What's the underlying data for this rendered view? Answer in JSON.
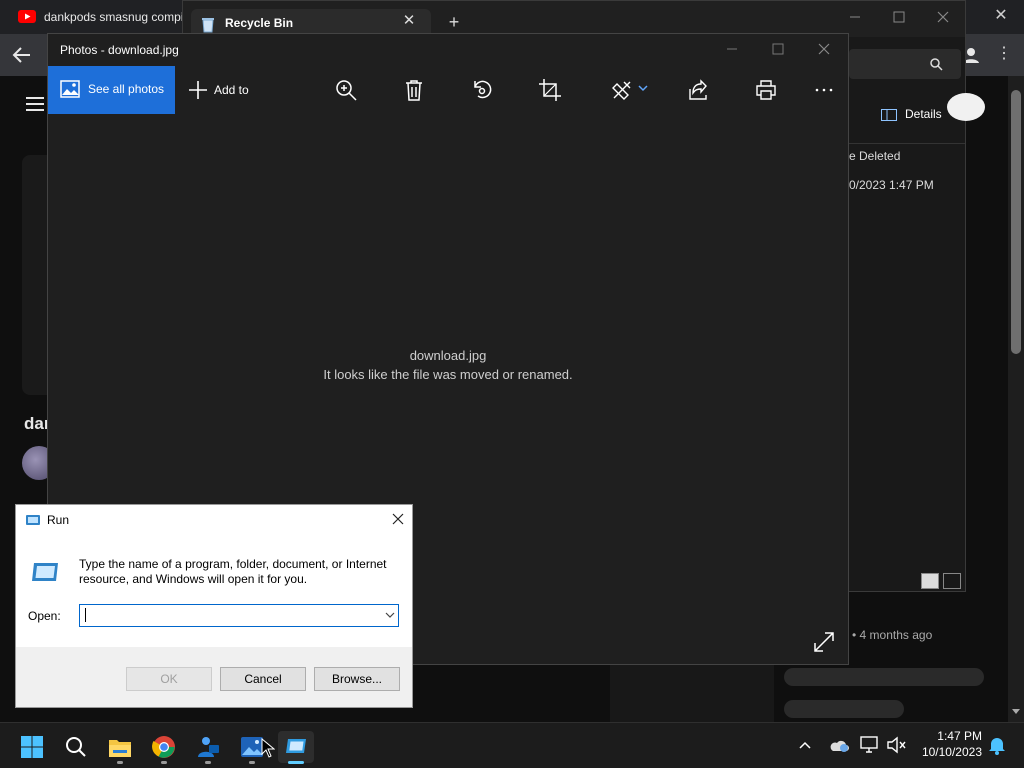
{
  "browser": {
    "tab_title": "dankpods smasnug compi",
    "channel_name_partial": "dar",
    "video_meta": "• 4 months ago",
    "close_label": "✕",
    "kebab": "⋮"
  },
  "explorer": {
    "tab_title": "Recycle Bin",
    "tab_close": "✕",
    "new_tab": "+",
    "details_label": "Details",
    "column_header_partial": "e Deleted",
    "date_partial": "0/2023 1:47 PM"
  },
  "photos": {
    "window_title": "Photos - download.jpg",
    "see_all_label": "See all photos",
    "add_to_label": "Add to",
    "filename": "download.jpg",
    "message": "It looks like the file was moved or renamed.",
    "toolbar_icons": [
      "zoom-in-icon",
      "delete-icon",
      "rotate-icon",
      "crop-icon",
      "edit-icon",
      "share-icon",
      "print-icon",
      "more-icon"
    ],
    "accent_color": "#1e6fd9"
  },
  "run_dialog": {
    "title": "Run",
    "description": "Type the name of a program, folder, document, or Internet resource, and Windows will open it for you.",
    "open_label": "Open:",
    "input_value": "",
    "ok_label": "OK",
    "cancel_label": "Cancel",
    "browse_label": "Browse..."
  },
  "taskbar": {
    "apps": [
      "start-icon",
      "search-icon",
      "file-explorer-icon",
      "chrome-icon",
      "teams-icon",
      "photos-icon",
      "run-icon"
    ],
    "time": "1:47 PM",
    "date": "10/10/2023",
    "tray_chevron": "^"
  }
}
